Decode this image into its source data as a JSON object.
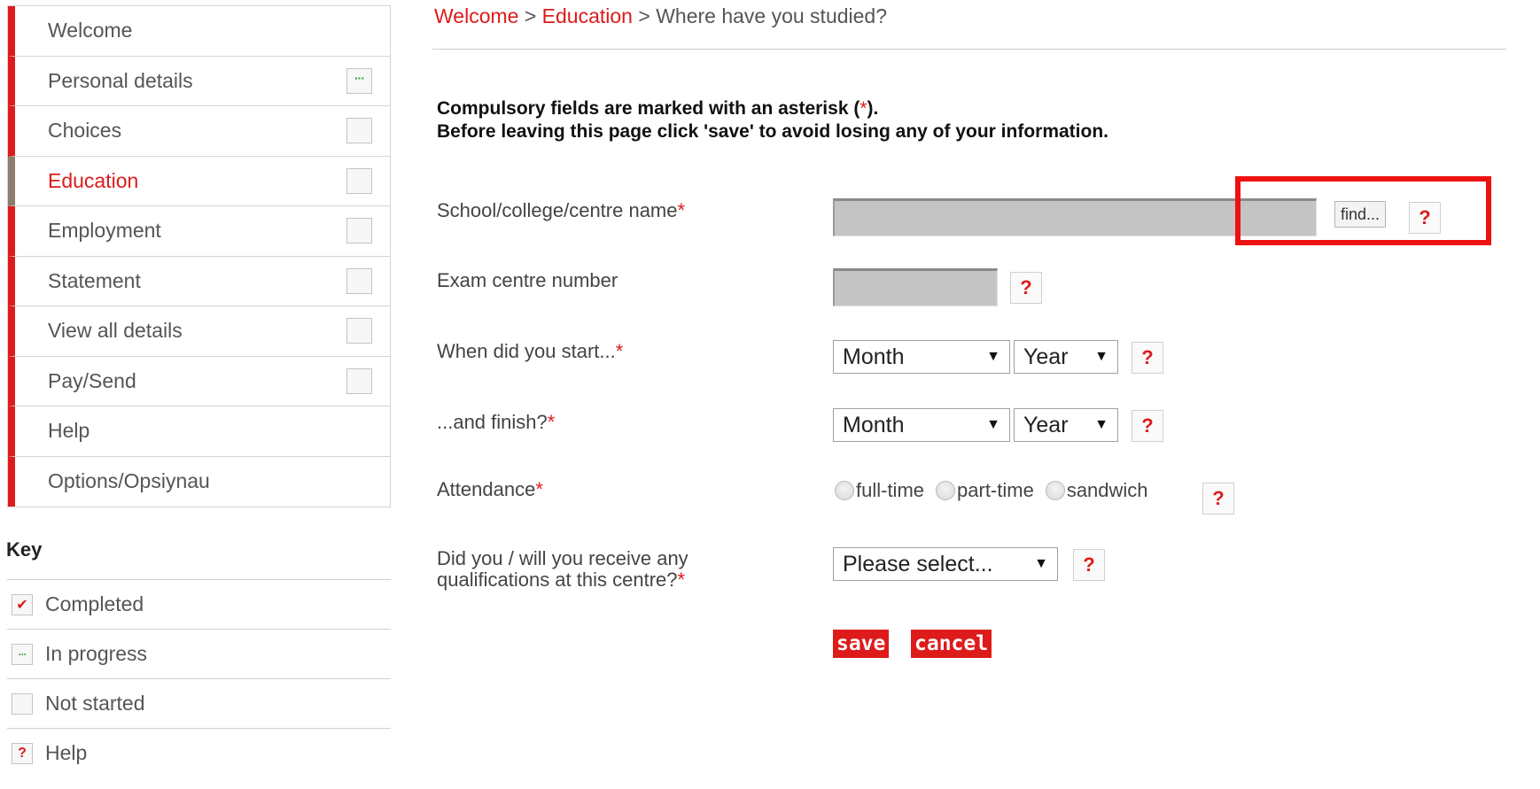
{
  "sidebar": {
    "items": [
      {
        "label": "Welcome",
        "status": ""
      },
      {
        "label": "Personal details",
        "status": "in-progress"
      },
      {
        "label": "Choices",
        "status": "not-started"
      },
      {
        "label": "Education",
        "status": "not-started"
      },
      {
        "label": "Employment",
        "status": "not-started"
      },
      {
        "label": "Statement",
        "status": "not-started"
      },
      {
        "label": "View all details",
        "status": "not-started"
      },
      {
        "label": "Pay/Send",
        "status": "not-started"
      },
      {
        "label": "Help",
        "status": ""
      },
      {
        "label": "Options/Opsiynau",
        "status": ""
      }
    ],
    "active": "Education"
  },
  "key": {
    "title": "Key",
    "items": [
      {
        "icon": "check-icon",
        "label": "Completed"
      },
      {
        "icon": "in-progress-icon",
        "label": "In progress"
      },
      {
        "icon": "not-started-icon",
        "label": "Not started"
      },
      {
        "icon": "help-icon",
        "label": "Help"
      }
    ]
  },
  "breadcrumb": {
    "welcome": "Welcome",
    "sep": " > ",
    "education": "Education",
    "current": "Where have you studied?"
  },
  "notice": {
    "line1_pre": "Compulsory fields are marked with an asterisk (",
    "asterisk": "*",
    "line1_post": ").",
    "line2": "Before leaving this page click 'save' to avoid losing any of your information."
  },
  "form": {
    "school_label": "School/college/centre name",
    "school_value": "",
    "find_label": "find...",
    "exam_label": "Exam centre number",
    "exam_value": "",
    "start_label": "When did you start...",
    "finish_label": "...and finish?",
    "month_placeholder": "Month",
    "year_placeholder": "Year",
    "attendance_label": "Attendance",
    "attendance_options": [
      "full-time",
      "part-time",
      "sandwich"
    ],
    "qual_label_line1": "Did you / will you receive any",
    "qual_label_line2": "qualifications at this centre?",
    "qual_placeholder": "Please select...",
    "required_mark": "*",
    "help_mark": "?",
    "save_label": "save",
    "cancel_label": "cancel"
  },
  "icons": {
    "dropdown_arrow": "▼",
    "check": "✔",
    "dots": "···"
  },
  "colors": {
    "accent": "#dd1b1b",
    "highlight": "#ee1111",
    "progress": "#3aa13a"
  }
}
